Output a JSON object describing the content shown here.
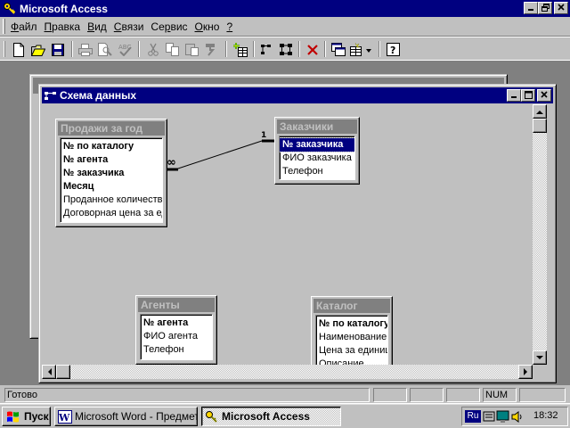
{
  "app": {
    "title": "Microsoft Access"
  },
  "menu": [
    "Файл",
    "Правка",
    "Вид",
    "Связи",
    "Сервис",
    "Окно",
    "?"
  ],
  "menu_accel": [
    "Ф",
    "П",
    "В",
    "С",
    "р",
    "О",
    "?"
  ],
  "window": {
    "title": "Схема данных"
  },
  "tables": [
    {
      "id": "prodazhi",
      "title": "Продажи за год",
      "fields": [
        {
          "text": "№ по каталогу",
          "key": true
        },
        {
          "text": "№ агента",
          "key": true
        },
        {
          "text": "№ заказчика",
          "key": true
        },
        {
          "text": "Месяц",
          "key": true
        },
        {
          "text": "Проданное количество",
          "key": false
        },
        {
          "text": "Договорная цена за единицу",
          "key": false
        }
      ]
    },
    {
      "id": "zakazchiki",
      "title": "Заказчики",
      "fields": [
        {
          "text": "№ заказчика",
          "key": true,
          "selected": true
        },
        {
          "text": "ФИО заказчика",
          "key": false
        },
        {
          "text": "Телефон",
          "key": false
        }
      ]
    },
    {
      "id": "agenty",
      "title": "Агенты",
      "fields": [
        {
          "text": "№ агента",
          "key": true
        },
        {
          "text": "ФИО агента",
          "key": false
        },
        {
          "text": "Телефон",
          "key": false
        }
      ]
    },
    {
      "id": "katalog",
      "title": "Каталог",
      "fields": [
        {
          "text": "№ по каталогу",
          "key": true
        },
        {
          "text": "Наименование изделия",
          "key": false
        },
        {
          "text": "Цена за единицу",
          "key": false
        },
        {
          "text": "Описание",
          "key": false
        }
      ]
    }
  ],
  "relationship": {
    "one_label": "1",
    "many_label": "∞"
  },
  "status": {
    "text": "Готово",
    "num": "NUM"
  },
  "taskbar": {
    "start": "Пуск",
    "tasks": [
      "Microsoft Word - Предметная область",
      "Microsoft Access"
    ],
    "lang": "Ru",
    "clock": "18:32"
  },
  "colors": {
    "title_active": "#000080",
    "title_inactive": "#808080",
    "face": "#c0c0c0",
    "desktop_mdi": "#808080"
  }
}
